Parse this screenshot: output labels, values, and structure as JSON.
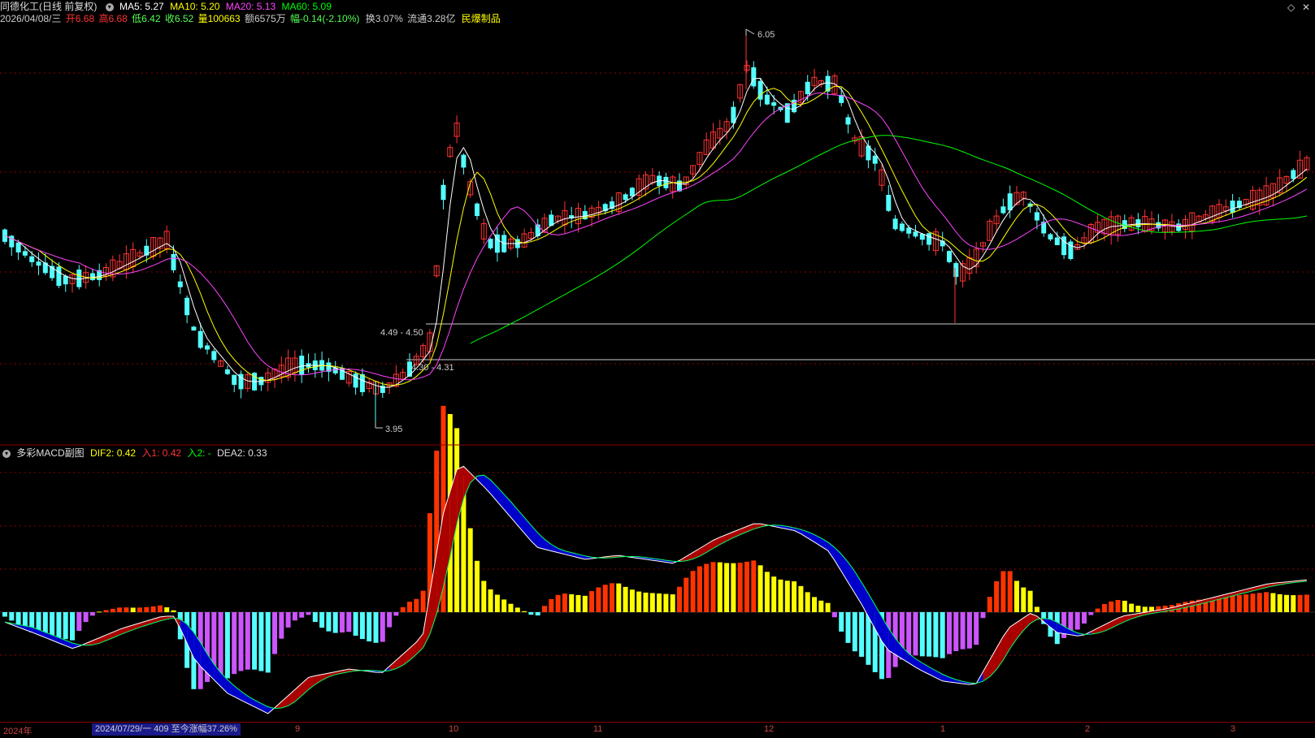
{
  "header": {
    "title": "同德化工(日线 前复权)",
    "ma_items": [
      {
        "label": "MA5: 5.27",
        "color": "#ffffff"
      },
      {
        "label": "MA10: 5.20",
        "color": "#ffff00"
      },
      {
        "label": "MA20: 5.13",
        "color": "#ff44ff"
      },
      {
        "label": "MA60: 5.09",
        "color": "#00ff00"
      }
    ],
    "quote": {
      "date": "2026/04/08/三",
      "open": "开6.68",
      "high": "高6.68",
      "low": "低6.42",
      "close": "收6.52",
      "volume": "量100663",
      "amount": "额6575万",
      "change": "幅-0.14(-2.10%)",
      "turnover": "换3.07%",
      "float_cap": "流通3.28亿",
      "sector": "民爆制品"
    }
  },
  "price_annotations": {
    "high_label": "6.05",
    "low_label": "3.95",
    "support_upper": "4.49 - 4.50",
    "support_lower": "4.30 - 4.31"
  },
  "sub_header": {
    "title": "多彩MACD副图",
    "dif2": "DIF2: 0.42",
    "in1": "入1: 0.42",
    "in2": "入2: -",
    "dea2": "DEA2: 0.33"
  },
  "x_axis": {
    "year_label": "2024年",
    "range_text": "2024/07/29/一 409 至今涨幅37.26%",
    "month_labels": [
      "9",
      "10",
      "11",
      "12",
      "1",
      "2",
      "3"
    ]
  },
  "colors": {
    "up": "#ff3333",
    "down": "#54ffff",
    "ma5": "#ffffff",
    "ma10": "#ffff00",
    "ma20": "#ff44ff",
    "ma60": "#00ff00",
    "grid": "#8b0000",
    "macd_pos_strong": "#ff3300",
    "macd_pos_weak": "#ffff00",
    "macd_neg_strong": "#54ffff",
    "macd_neg_weak": "#cc55ff",
    "ribbon_up": "#aa0000",
    "ribbon_down": "#0000cc"
  },
  "controls": {
    "restore_icon": "diamond-icon",
    "close_icon": "close-icon"
  }
}
